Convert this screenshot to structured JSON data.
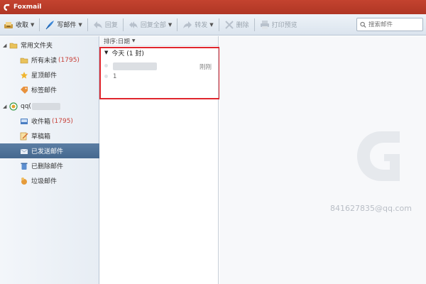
{
  "app": {
    "title": "Foxmail"
  },
  "toolbar": {
    "receive": "收取",
    "compose": "写邮件",
    "reply": "回复",
    "reply_all": "回复全部",
    "forward": "转发",
    "delete": "删除",
    "print_preview": "打印预览",
    "search_placeholder": "搜索邮件"
  },
  "sidebar": {
    "common_folder": "常用文件夹",
    "all_unread": "所有未读",
    "all_unread_count": "(1795)",
    "starred": "星顶邮件",
    "tagged": "标签邮件",
    "account": "qq(",
    "inbox": "收件箱",
    "inbox_count": "(1795)",
    "drafts": "草稿箱",
    "sent": "已发送邮件",
    "deleted": "已删除邮件",
    "junk": "垃圾邮件"
  },
  "maillist": {
    "sort_label": "排序:日期",
    "group_label": "今天 (1 封)",
    "items": [
      {
        "time": "刚刚",
        "subject": "1"
      }
    ]
  },
  "preview": {
    "email": "841627835@qq.com"
  },
  "colors": {
    "titlebar": "#b03624",
    "selected": "#4e7198",
    "highlight": "#e0262e",
    "count": "#c8423a"
  }
}
